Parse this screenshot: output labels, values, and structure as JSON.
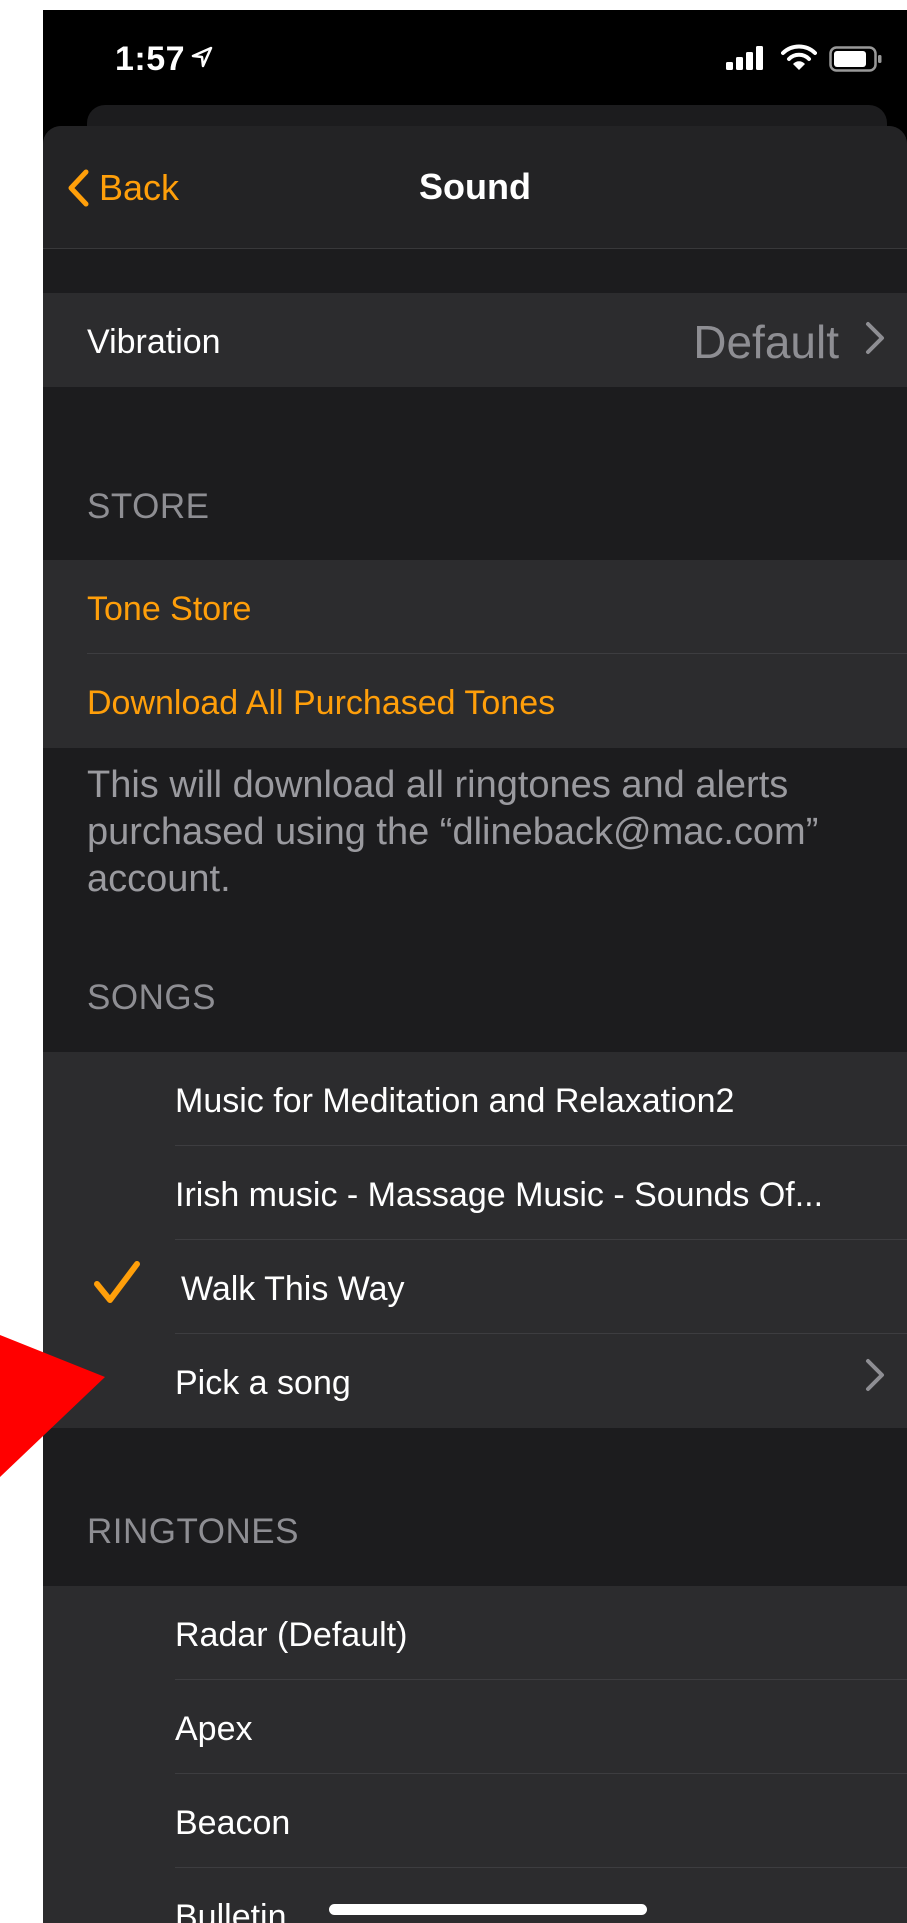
{
  "status_bar": {
    "time": "1:57"
  },
  "nav": {
    "back_label": "Back",
    "title": "Sound"
  },
  "vibration": {
    "label": "Vibration",
    "value": "Default"
  },
  "store": {
    "header": "STORE",
    "tone_store": "Tone Store",
    "download_all": "Download All Purchased Tones",
    "footer": "This will download all ringtones and alerts purchased using the “dlineback@mac.com” account."
  },
  "songs": {
    "header": "SONGS",
    "items": [
      {
        "label": "Music for Meditation and Relaxation2",
        "selected": false
      },
      {
        "label": "Irish music - Massage Music - Sounds Of...",
        "selected": false
      },
      {
        "label": "Walk This Way",
        "selected": true
      }
    ],
    "pick": "Pick a song"
  },
  "ringtones": {
    "header": "RINGTONES",
    "items": [
      {
        "label": "Radar (Default)"
      },
      {
        "label": "Apex"
      },
      {
        "label": "Beacon"
      },
      {
        "label": "Bulletin"
      }
    ]
  },
  "colors": {
    "accent": "#ff9f0a",
    "background": "#1c1c1e",
    "cell": "#2c2c2e",
    "annotation_arrow": "#ff0000"
  }
}
